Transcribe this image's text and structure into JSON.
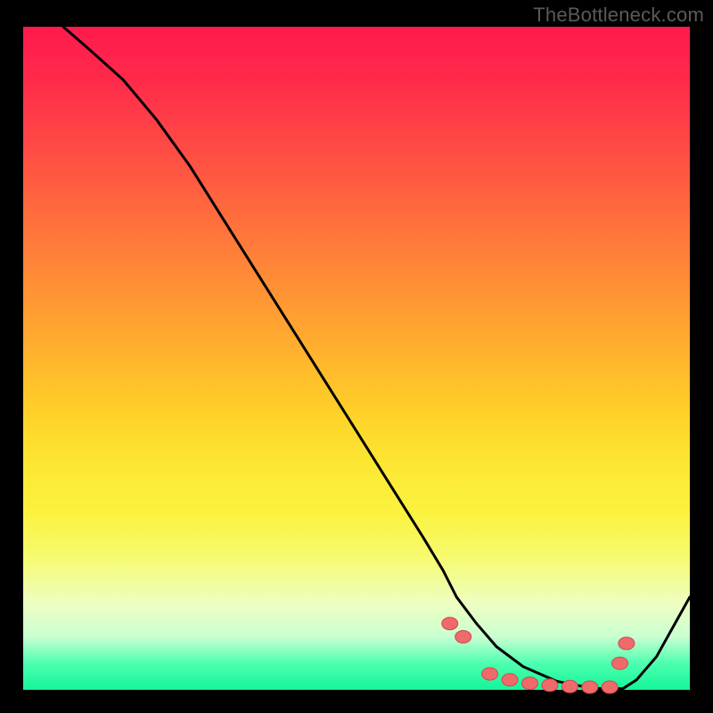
{
  "watermark": "TheBottleneck.com",
  "colors": {
    "page_bg": "#000000",
    "curve_stroke": "#000000",
    "dot_fill": "#ef6a6a",
    "dot_stroke": "#cf4a4a",
    "watermark_text": "#5a5a5a"
  },
  "chart_data": {
    "type": "line",
    "title": "",
    "xlabel": "",
    "ylabel": "",
    "xlim": [
      0,
      100
    ],
    "ylim": [
      0,
      100
    ],
    "grid": false,
    "legend": false,
    "series": [
      {
        "name": "curve",
        "x": [
          6,
          10,
          15,
          20,
          25,
          30,
          35,
          40,
          45,
          50,
          55,
          60,
          63,
          65,
          68,
          71,
          75,
          80,
          85,
          88,
          90,
          92,
          95,
          100
        ],
        "y": [
          100,
          96.5,
          92,
          86,
          79,
          71,
          63,
          55,
          47,
          39,
          31,
          23,
          18,
          14,
          10,
          6.5,
          3.5,
          1.3,
          0.3,
          0.1,
          0.2,
          1.5,
          5,
          14
        ]
      }
    ],
    "dots": {
      "x": [
        64,
        66,
        70,
        73,
        76,
        79,
        82,
        85,
        88,
        89.5,
        90.5
      ],
      "y": [
        10,
        8,
        2.4,
        1.5,
        1.0,
        0.7,
        0.5,
        0.4,
        0.4,
        4,
        7
      ]
    }
  }
}
